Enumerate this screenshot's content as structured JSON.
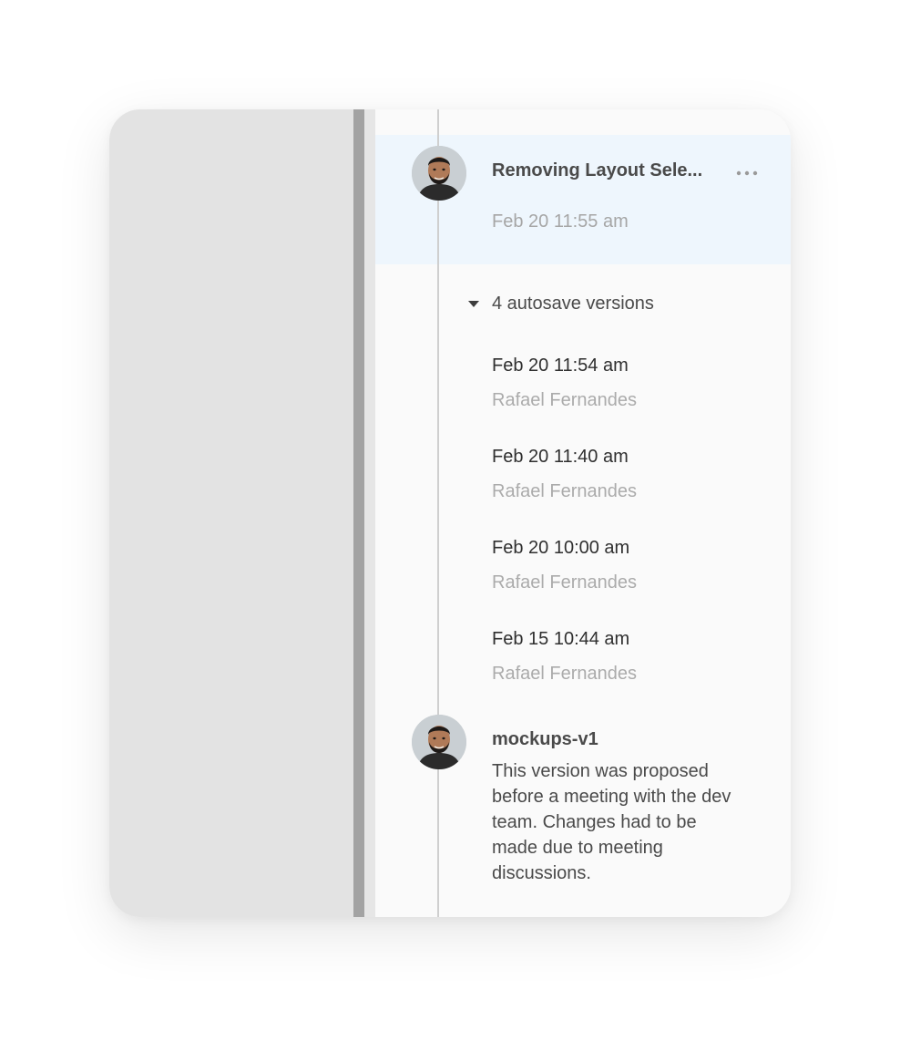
{
  "version_history": {
    "selected_version": {
      "title": "Removing Layout Sele...",
      "date": "Feb 20 11:55 am",
      "more_icon": "more-horizontal-icon"
    },
    "autosave_group": {
      "label": "4 autosave versions",
      "icon": "caret-down-icon",
      "expanded": true,
      "items": [
        {
          "date": "Feb 20 11:54 am",
          "author": "Rafael Fernandes"
        },
        {
          "date": "Feb 20 11:40 am",
          "author": "Rafael Fernandes"
        },
        {
          "date": "Feb 20 10:00 am",
          "author": "Rafael Fernandes"
        },
        {
          "date": "Feb 15 10:44 am",
          "author": "Rafael Fernandes"
        }
      ]
    },
    "named_version": {
      "title": "mockups-v1",
      "description": "This version was proposed before a meeting with the dev team. Changes had to be made due to meeting discussions."
    }
  },
  "colors": {
    "selected_background": "#eef6fd",
    "timeline": "#cfcfcf",
    "muted_text": "#a6a6a6",
    "primary_text": "#4a4a4a"
  }
}
